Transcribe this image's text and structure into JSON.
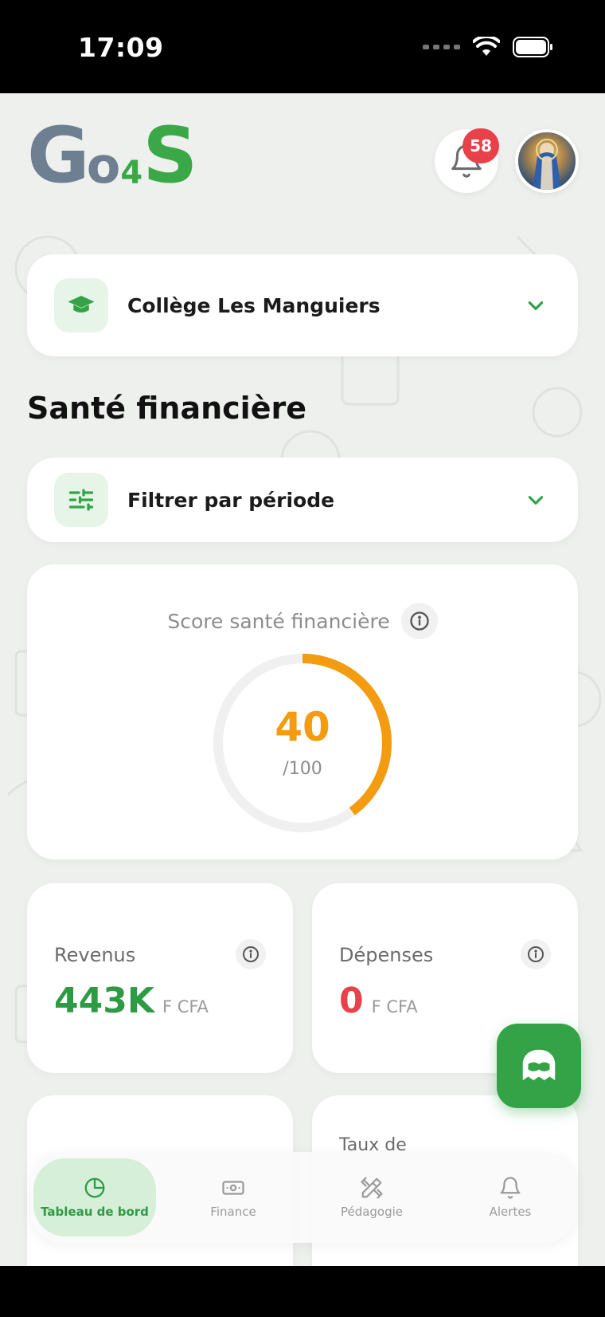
{
  "status_bar": {
    "time": "17:09"
  },
  "header": {
    "logo": {
      "g": "G",
      "o": "o",
      "four": "4",
      "s": "S"
    },
    "notifications_count": "58"
  },
  "school_selector": {
    "label": "Collège Les Manguiers"
  },
  "section": {
    "title": "Santé financière"
  },
  "period_filter": {
    "label": "Filtrer par période"
  },
  "score": {
    "label": "Score santé financière",
    "value": "40",
    "max": "/100",
    "fraction": 0.4
  },
  "stats": [
    {
      "label": "Revenus",
      "value": "443K",
      "unit": "F CFA",
      "color": "#2e9b44"
    },
    {
      "label": "Dépenses",
      "value": "0",
      "unit": "F CFA",
      "color": "#e8414a"
    }
  ],
  "partial_cards": [
    {
      "label": ""
    },
    {
      "label": "Taux de"
    }
  ],
  "nav": {
    "items": [
      {
        "label": "Tableau de bord",
        "icon": "chart-pie-icon",
        "active": true
      },
      {
        "label": "Finance",
        "icon": "banknote-icon",
        "active": false
      },
      {
        "label": "Pédagogie",
        "icon": "pencil-ruler-icon",
        "active": false
      },
      {
        "label": "Alertes",
        "icon": "bell-icon",
        "active": false
      }
    ]
  },
  "colors": {
    "brand_green": "#34a347",
    "brand_gray": "#6e7f92",
    "score_orange": "#f39c12",
    "badge_red": "#e8414a"
  }
}
